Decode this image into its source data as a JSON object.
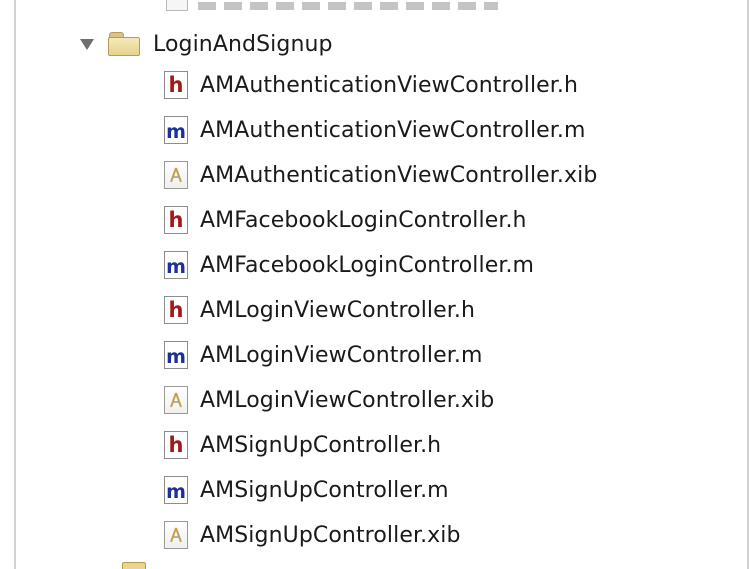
{
  "project_navigator": {
    "group": {
      "name": "LoginAndSignup",
      "icon": "folder-icon",
      "expanded": true
    },
    "files": [
      {
        "name": "AMAuthenticationViewController.h",
        "type": "h",
        "icon": "header-file-icon",
        "glyph": "h"
      },
      {
        "name": "AMAuthenticationViewController.m",
        "type": "m",
        "icon": "implementation-file-icon",
        "glyph": "m"
      },
      {
        "name": "AMAuthenticationViewController.xib",
        "type": "xib",
        "icon": "xib-file-icon",
        "glyph": ""
      },
      {
        "name": "AMFacebookLoginController.h",
        "type": "h",
        "icon": "header-file-icon",
        "glyph": "h"
      },
      {
        "name": "AMFacebookLoginController.m",
        "type": "m",
        "icon": "implementation-file-icon",
        "glyph": "m"
      },
      {
        "name": "AMLoginViewController.h",
        "type": "h",
        "icon": "header-file-icon",
        "glyph": "h"
      },
      {
        "name": "AMLoginViewController.m",
        "type": "m",
        "icon": "implementation-file-icon",
        "glyph": "m"
      },
      {
        "name": "AMLoginViewController.xib",
        "type": "xib",
        "icon": "xib-file-icon",
        "glyph": ""
      },
      {
        "name": "AMSignUpController.h",
        "type": "h",
        "icon": "header-file-icon",
        "glyph": "h"
      },
      {
        "name": "AMSignUpController.m",
        "type": "m",
        "icon": "implementation-file-icon",
        "glyph": "m"
      },
      {
        "name": "AMSignUpController.xib",
        "type": "xib",
        "icon": "xib-file-icon",
        "glyph": ""
      }
    ]
  },
  "colors": {
    "header_glyph": "#a2191c",
    "implementation_glyph": "#1c2f9c",
    "folder": "#e6d38f",
    "disclosure": "#6f6f6f"
  }
}
